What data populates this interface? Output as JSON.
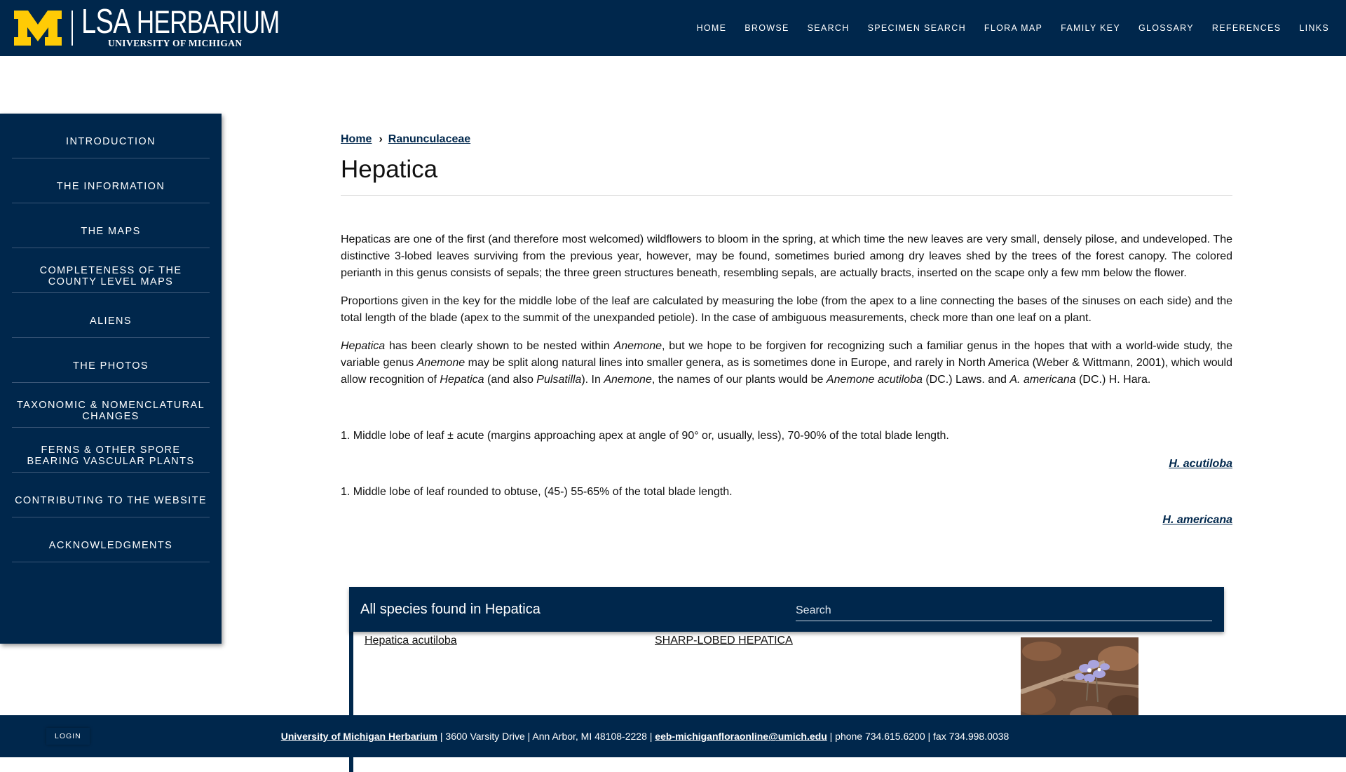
{
  "header": {
    "logo_main": "HERBARIUM",
    "logo_lsa": "LSA",
    "logo_sub": "UNIVERSITY OF MICHIGAN",
    "nav": [
      "HOME",
      "BROWSE",
      "SEARCH",
      "SPECIMEN SEARCH",
      "FLORA MAP",
      "FAMILY KEY",
      "GLOSSARY",
      "REFERENCES",
      "LINKS"
    ]
  },
  "sidebar": {
    "items": [
      "INTRODUCTION",
      "THE INFORMATION",
      "THE MAPS",
      "COMPLETENESS OF THE COUNTY LEVEL MAPS",
      "ALIENS",
      "THE PHOTOS",
      "TAXONOMIC & NOMENCLATURAL CHANGES",
      "FERNS & OTHER SPORE BEARING VASCULAR PLANTS",
      "CONTRIBUTING TO THE WEBSITE",
      "ACKNOWLEDGMENTS"
    ]
  },
  "breadcrumb": {
    "home": "Home",
    "separator": "›",
    "family": " Ranunculaceae"
  },
  "page_title": "Hepatica",
  "paragraphs": {
    "p1": "Hepaticas are one of the first (and therefore most welcomed) wildflowers to bloom in the spring, at which time the new leaves are very small, densely pilose, and undeveloped. The distinctive 3-lobed leaves surviving from the previous year, however, may be found, sometimes buried among dry leaves shed by the trees of the forest canopy. The colored perianth in this genus consists of sepals; the three green structures beneath, resembling sepals, are actually bracts, inserted on the scape only a few mm below the flower.",
    "p2": "Proportions given in the key for the middle lobe of the leaf are calculated by measuring the lobe (from the apex to a line connecting the bases of the sinuses on each side) and the total length of the blade (apex to the summit of the unexpanded petiole). In the case of ambiguous measurements, check more than one leaf on a plant.",
    "p3": {
      "s1": "Hepatica",
      "s2": " has been clearly shown to be nested within ",
      "s3": "Anemone",
      "s4": ", but we hope to be forgiven for recognizing such a familiar genus in the hopes that with a world-wide study, the variable genus ",
      "s5": "Anemone",
      "s6": " may be split along natural lines into smaller genera, as is sometimes done in Europe, and rarely in North America (Weber & Wittmann, 2001), which would allow recognition of ",
      "s7": "Hepatica",
      "s8": " (and also ",
      "s9": "Pulsatilla",
      "s10": "). In ",
      "s11": "Anemone",
      "s12": ", the names of our plants would be ",
      "s13": "Anemone acutiloba",
      "s14": " (DC.) Laws. and ",
      "s15": "A. americana",
      "s16": " (DC.) H. Hara."
    }
  },
  "key": [
    {
      "text": "1. Middle lobe of leaf ± acute (margins approaching apex at angle of 90° or, usually, less), 70-90% of the total blade length.",
      "target": "H. acutiloba"
    },
    {
      "text": "1. Middle lobe of leaf rounded to obtuse, (45-) 55-65% of the total blade length.",
      "target": "H. americana"
    }
  ],
  "species_panel": {
    "title": "All species found in Hepatica",
    "search_placeholder": "Search",
    "rows": [
      {
        "scientific": "Hepatica acutiloba",
        "common": "SHARP-LOBED HEPATICA"
      }
    ]
  },
  "footer": {
    "login": "LOGIN",
    "org": "University of Michigan Herbarium",
    "address": " | 3600 Varsity Drive | Ann Arbor, MI 48108-2228 | ",
    "email": "eeb-michiganfloraonline@umich.edu",
    "contact": " | phone 734.615.6200 | fax 734.998.0038"
  },
  "colors": {
    "navy": "#00274c",
    "maize": "#ffcb05"
  }
}
